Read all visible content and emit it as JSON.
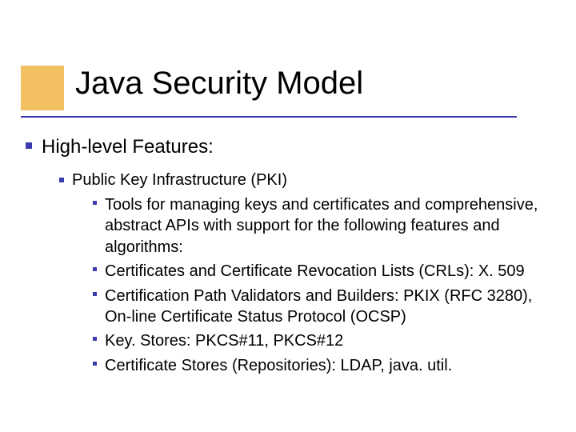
{
  "title": "Java Security Model",
  "lvl1": "High-level Features:",
  "lvl2": "Public Key Infrastructure (PKI)",
  "lvl3": [
    "Tools for managing keys and certificates and comprehensive, abstract APIs with support for the following features and algorithms:",
    "Certificates and Certificate Revocation Lists (CRLs): X. 509",
    "Certification Path Validators and Builders: PKIX (RFC 3280), On-line Certificate Status Protocol (OCSP)",
    "Key. Stores: PKCS#11, PKCS#12",
    "Certificate Stores (Repositories): LDAP, java. util."
  ]
}
